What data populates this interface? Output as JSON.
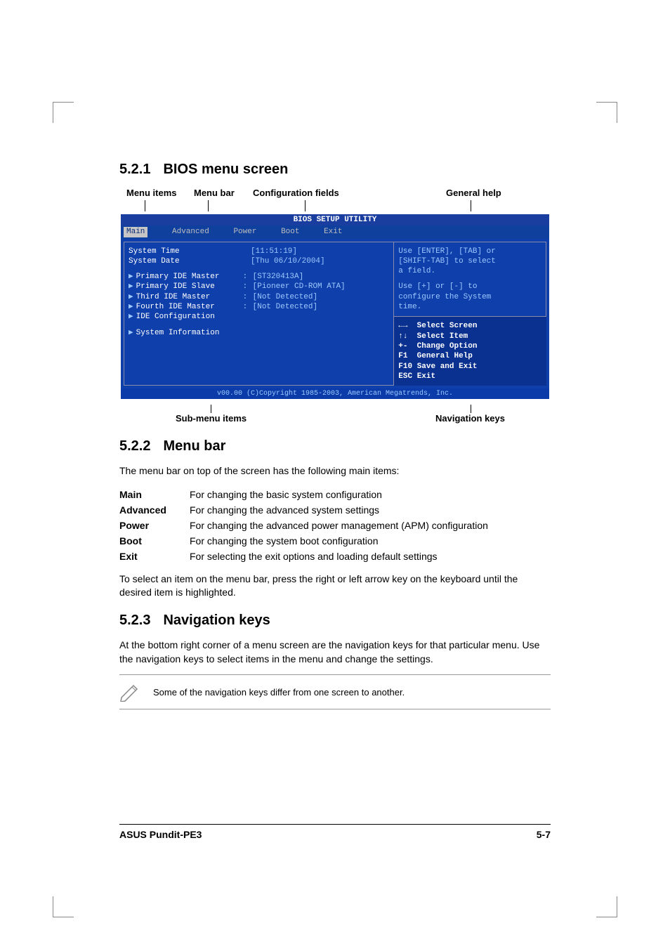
{
  "sections": {
    "s1": {
      "num": "5.2.1",
      "title": "BIOS menu screen"
    },
    "s2": {
      "num": "5.2.2",
      "title": "Menu bar"
    },
    "s3": {
      "num": "5.2.3",
      "title": "Navigation keys"
    }
  },
  "diagram_labels": {
    "menu_items": "Menu items",
    "menu_bar": "Menu bar",
    "config_fields": "Configuration fields",
    "general_help": "General help",
    "sub_menu_items": "Sub-menu items",
    "navigation_keys": "Navigation keys"
  },
  "bios": {
    "title": "BIOS SETUP UTILITY",
    "tabs": {
      "main": "Main",
      "advanced": "Advanced",
      "power": "Power",
      "boot": "Boot",
      "exit": "Exit"
    },
    "fields": {
      "system_time": {
        "label": "System Time",
        "value": "[11:51:19]"
      },
      "system_date": {
        "label": "System Date",
        "value": "[Thu 06/10/2004]"
      },
      "primary_master": {
        "label": "Primary IDE Master",
        "value": "[ST320413A]"
      },
      "primary_slave": {
        "label": "Primary IDE Slave",
        "value": "[Pioneer CD-ROM ATA]"
      },
      "third_master": {
        "label": "Third IDE Master",
        "value": "[Not Detected]"
      },
      "fourth_master": {
        "label": "Fourth IDE Master",
        "value": "[Not Detected]"
      },
      "ide_config": {
        "label": "IDE Configuration"
      },
      "sys_info": {
        "label": "System Information"
      }
    },
    "help": {
      "line1": "Use [ENTER], [TAB] or",
      "line2": "[SHIFT-TAB] to select",
      "line3": "a field.",
      "line4": "Use [+] or [-] to",
      "line5": "configure the System",
      "line6": "time."
    },
    "nav": {
      "r1": {
        "key": "←→",
        "text": "Select Screen"
      },
      "r2": {
        "key": "↑↓",
        "text": "Select Item"
      },
      "r3": {
        "key": "+-",
        "text": "Change Option"
      },
      "r4": {
        "key": "F1",
        "text": "General Help"
      },
      "r5": {
        "key": "F10",
        "text": "Save and Exit"
      },
      "r6": {
        "key": "ESC",
        "text": "Exit"
      }
    },
    "footer": "v00.00 (C)Copyright 1985-2003, American Megatrends, Inc."
  },
  "menu_bar_text": {
    "intro": "The menu bar on top of the screen has the following main items:",
    "items": {
      "main": {
        "label": "Main",
        "desc": "For changing the basic system configuration"
      },
      "advanced": {
        "label": "Advanced",
        "desc": "For changing the advanced system settings"
      },
      "power": {
        "label": "Power",
        "desc": "For changing the advanced power management (APM) configuration"
      },
      "boot": {
        "label": "Boot",
        "desc": "For changing the system boot configuration"
      },
      "exit": {
        "label": "Exit",
        "desc": "For selecting the exit options and loading default settings"
      }
    },
    "outro": "To select an item on the menu bar, press the right or left arrow key on the keyboard until the desired item is highlighted."
  },
  "nav_keys_text": {
    "para": "At the bottom right corner of a menu screen are the navigation keys for that particular menu. Use the navigation keys to select items in the menu and change the settings.",
    "note": "Some of the navigation keys differ from one screen to another."
  },
  "footer": {
    "left": "ASUS Pundit-PE3",
    "right": "5-7"
  }
}
